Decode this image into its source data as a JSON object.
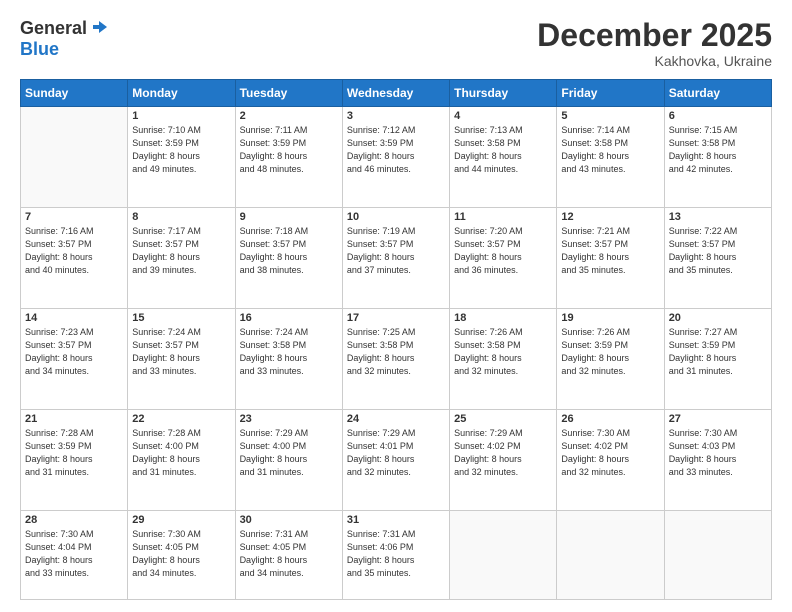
{
  "header": {
    "logo_general": "General",
    "logo_blue": "Blue",
    "month": "December 2025",
    "location": "Kakhovka, Ukraine"
  },
  "weekdays": [
    "Sunday",
    "Monday",
    "Tuesday",
    "Wednesday",
    "Thursday",
    "Friday",
    "Saturday"
  ],
  "weeks": [
    [
      {
        "day": "",
        "info": ""
      },
      {
        "day": "1",
        "info": "Sunrise: 7:10 AM\nSunset: 3:59 PM\nDaylight: 8 hours\nand 49 minutes."
      },
      {
        "day": "2",
        "info": "Sunrise: 7:11 AM\nSunset: 3:59 PM\nDaylight: 8 hours\nand 48 minutes."
      },
      {
        "day": "3",
        "info": "Sunrise: 7:12 AM\nSunset: 3:59 PM\nDaylight: 8 hours\nand 46 minutes."
      },
      {
        "day": "4",
        "info": "Sunrise: 7:13 AM\nSunset: 3:58 PM\nDaylight: 8 hours\nand 44 minutes."
      },
      {
        "day": "5",
        "info": "Sunrise: 7:14 AM\nSunset: 3:58 PM\nDaylight: 8 hours\nand 43 minutes."
      },
      {
        "day": "6",
        "info": "Sunrise: 7:15 AM\nSunset: 3:58 PM\nDaylight: 8 hours\nand 42 minutes."
      }
    ],
    [
      {
        "day": "7",
        "info": "Sunrise: 7:16 AM\nSunset: 3:57 PM\nDaylight: 8 hours\nand 40 minutes."
      },
      {
        "day": "8",
        "info": "Sunrise: 7:17 AM\nSunset: 3:57 PM\nDaylight: 8 hours\nand 39 minutes."
      },
      {
        "day": "9",
        "info": "Sunrise: 7:18 AM\nSunset: 3:57 PM\nDaylight: 8 hours\nand 38 minutes."
      },
      {
        "day": "10",
        "info": "Sunrise: 7:19 AM\nSunset: 3:57 PM\nDaylight: 8 hours\nand 37 minutes."
      },
      {
        "day": "11",
        "info": "Sunrise: 7:20 AM\nSunset: 3:57 PM\nDaylight: 8 hours\nand 36 minutes."
      },
      {
        "day": "12",
        "info": "Sunrise: 7:21 AM\nSunset: 3:57 PM\nDaylight: 8 hours\nand 35 minutes."
      },
      {
        "day": "13",
        "info": "Sunrise: 7:22 AM\nSunset: 3:57 PM\nDaylight: 8 hours\nand 35 minutes."
      }
    ],
    [
      {
        "day": "14",
        "info": "Sunrise: 7:23 AM\nSunset: 3:57 PM\nDaylight: 8 hours\nand 34 minutes."
      },
      {
        "day": "15",
        "info": "Sunrise: 7:24 AM\nSunset: 3:57 PM\nDaylight: 8 hours\nand 33 minutes."
      },
      {
        "day": "16",
        "info": "Sunrise: 7:24 AM\nSunset: 3:58 PM\nDaylight: 8 hours\nand 33 minutes."
      },
      {
        "day": "17",
        "info": "Sunrise: 7:25 AM\nSunset: 3:58 PM\nDaylight: 8 hours\nand 32 minutes."
      },
      {
        "day": "18",
        "info": "Sunrise: 7:26 AM\nSunset: 3:58 PM\nDaylight: 8 hours\nand 32 minutes."
      },
      {
        "day": "19",
        "info": "Sunrise: 7:26 AM\nSunset: 3:59 PM\nDaylight: 8 hours\nand 32 minutes."
      },
      {
        "day": "20",
        "info": "Sunrise: 7:27 AM\nSunset: 3:59 PM\nDaylight: 8 hours\nand 31 minutes."
      }
    ],
    [
      {
        "day": "21",
        "info": "Sunrise: 7:28 AM\nSunset: 3:59 PM\nDaylight: 8 hours\nand 31 minutes."
      },
      {
        "day": "22",
        "info": "Sunrise: 7:28 AM\nSunset: 4:00 PM\nDaylight: 8 hours\nand 31 minutes."
      },
      {
        "day": "23",
        "info": "Sunrise: 7:29 AM\nSunset: 4:00 PM\nDaylight: 8 hours\nand 31 minutes."
      },
      {
        "day": "24",
        "info": "Sunrise: 7:29 AM\nSunset: 4:01 PM\nDaylight: 8 hours\nand 32 minutes."
      },
      {
        "day": "25",
        "info": "Sunrise: 7:29 AM\nSunset: 4:02 PM\nDaylight: 8 hours\nand 32 minutes."
      },
      {
        "day": "26",
        "info": "Sunrise: 7:30 AM\nSunset: 4:02 PM\nDaylight: 8 hours\nand 32 minutes."
      },
      {
        "day": "27",
        "info": "Sunrise: 7:30 AM\nSunset: 4:03 PM\nDaylight: 8 hours\nand 33 minutes."
      }
    ],
    [
      {
        "day": "28",
        "info": "Sunrise: 7:30 AM\nSunset: 4:04 PM\nDaylight: 8 hours\nand 33 minutes."
      },
      {
        "day": "29",
        "info": "Sunrise: 7:30 AM\nSunset: 4:05 PM\nDaylight: 8 hours\nand 34 minutes."
      },
      {
        "day": "30",
        "info": "Sunrise: 7:31 AM\nSunset: 4:05 PM\nDaylight: 8 hours\nand 34 minutes."
      },
      {
        "day": "31",
        "info": "Sunrise: 7:31 AM\nSunset: 4:06 PM\nDaylight: 8 hours\nand 35 minutes."
      },
      {
        "day": "",
        "info": ""
      },
      {
        "day": "",
        "info": ""
      },
      {
        "day": "",
        "info": ""
      }
    ]
  ]
}
